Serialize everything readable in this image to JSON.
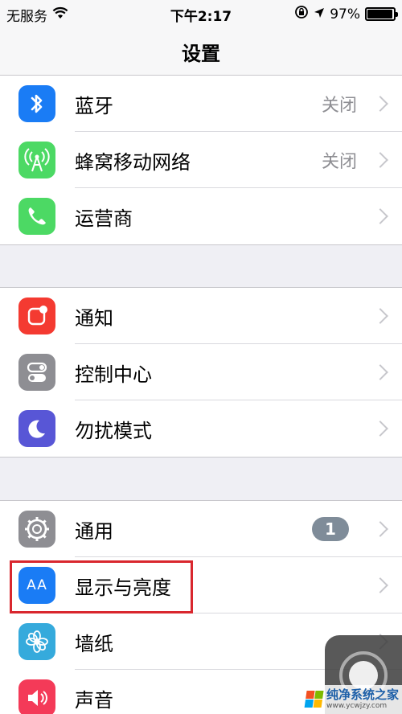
{
  "status_bar": {
    "carrier": "无服务",
    "time": "下午2:17",
    "battery": "97%",
    "battery_level": 0.97
  },
  "nav": {
    "title": "设置"
  },
  "groups": [
    {
      "rows": [
        {
          "label": "蓝牙",
          "value": "关闭",
          "icon": "bluetooth-icon",
          "color": "#1a7cf5"
        },
        {
          "label": "蜂窝移动网络",
          "value": "关闭",
          "icon": "antenna-icon",
          "color": "#4cd964"
        },
        {
          "label": "运营商",
          "value": "",
          "icon": "phone-icon",
          "color": "#4cd964"
        }
      ]
    },
    {
      "rows": [
        {
          "label": "通知",
          "value": "",
          "icon": "notification-icon",
          "color": "#f43a31"
        },
        {
          "label": "控制中心",
          "value": "",
          "icon": "toggles-icon",
          "color": "#8e8e93"
        },
        {
          "label": "勿扰模式",
          "value": "",
          "icon": "moon-icon",
          "color": "#5856d6"
        }
      ]
    },
    {
      "rows": [
        {
          "label": "通用",
          "value": "",
          "badge": "1",
          "icon": "gear-icon",
          "color": "#8e8e93"
        },
        {
          "label": "显示与亮度",
          "value": "",
          "icon": "text-size-icon",
          "color": "#1a7cf5",
          "icon_text": "AA"
        },
        {
          "label": "墙纸",
          "value": "",
          "icon": "flower-icon",
          "color": "#35aadc"
        },
        {
          "label": "声音",
          "value": "",
          "icon": "speaker-icon",
          "color": "#f43a58"
        }
      ]
    }
  ],
  "watermark": {
    "text": "纯净系统之家",
    "url": "www.ycwjzy.com"
  }
}
